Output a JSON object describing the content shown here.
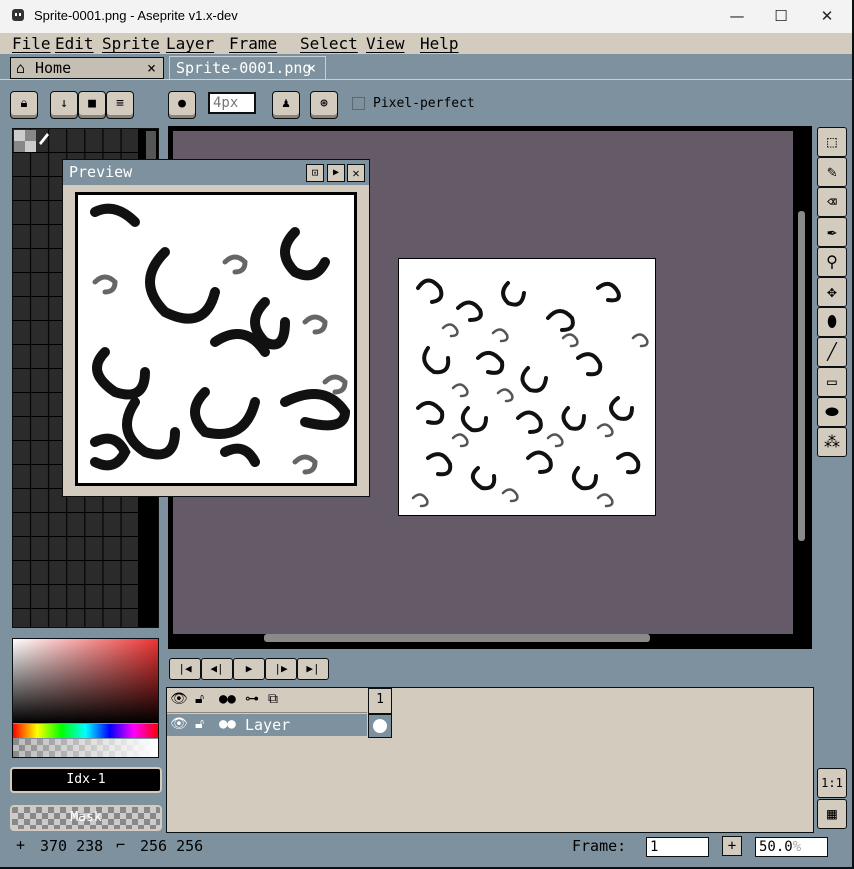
{
  "window": {
    "title": "Sprite-0001.png - Aseprite v1.x-dev",
    "minimize": "—",
    "maximize": "☐",
    "close": "✕"
  },
  "menu": [
    "File",
    "Edit",
    "Sprite",
    "Layer",
    "Frame",
    "Select",
    "View",
    "Help"
  ],
  "tabs": [
    {
      "label": "Home",
      "close": "×"
    },
    {
      "label": "Sprite-0001.png",
      "close": "×"
    }
  ],
  "context_bar": {
    "brush_size_placeholder": "4px",
    "pixel_perfect_label": "Pixel-perfect"
  },
  "preview": {
    "title": "Preview"
  },
  "color_bar": {
    "index_label": "Idx-1",
    "mask_label": "Mask"
  },
  "timeline": {
    "frame_header": "1",
    "layer_name": "Layer"
  },
  "status": {
    "cursor_pos": "370 238",
    "sprite_size": "256 256",
    "frame_label": "Frame:",
    "frame_value": "1",
    "zoom_value": "50.0",
    "zoom_unit": "%"
  },
  "zoom_button": "1:1",
  "colors": {
    "background": "#7d929e",
    "panel": "#d3cbbe",
    "canvas_bg": "#645a68",
    "dark": "#0a0f12"
  }
}
